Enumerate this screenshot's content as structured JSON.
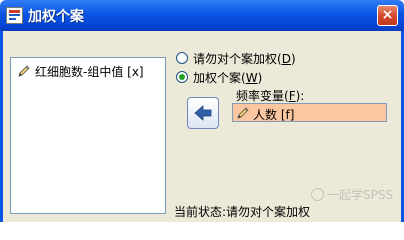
{
  "window": {
    "title": "加权个案",
    "close_symbol": "×",
    "accent_color": "#0a55e4"
  },
  "variable_list": {
    "items": [
      {
        "label": "红细胞数-组中值 [x]",
        "icon": "pencil-icon"
      }
    ]
  },
  "weighting": {
    "option_no_weight": {
      "text": "请勿对个案加权(",
      "mnemonic": "D",
      "suffix": ")",
      "selected": false
    },
    "option_weight_by": {
      "text": "加权个案(",
      "mnemonic": "W",
      "suffix": ")",
      "selected": true
    },
    "frequency_label": {
      "text": "频率变量(",
      "mnemonic": "F",
      "suffix": "):"
    },
    "frequency_value": "人数 [f]",
    "frequency_value_icon": "pencil-icon",
    "move_button_icon": "left-arrow-icon",
    "field_highlight_color": "#fbc7a1"
  },
  "status": {
    "text": "当前状态:请勿对个案加权"
  },
  "watermark": {
    "text": "一起学SPSS"
  }
}
